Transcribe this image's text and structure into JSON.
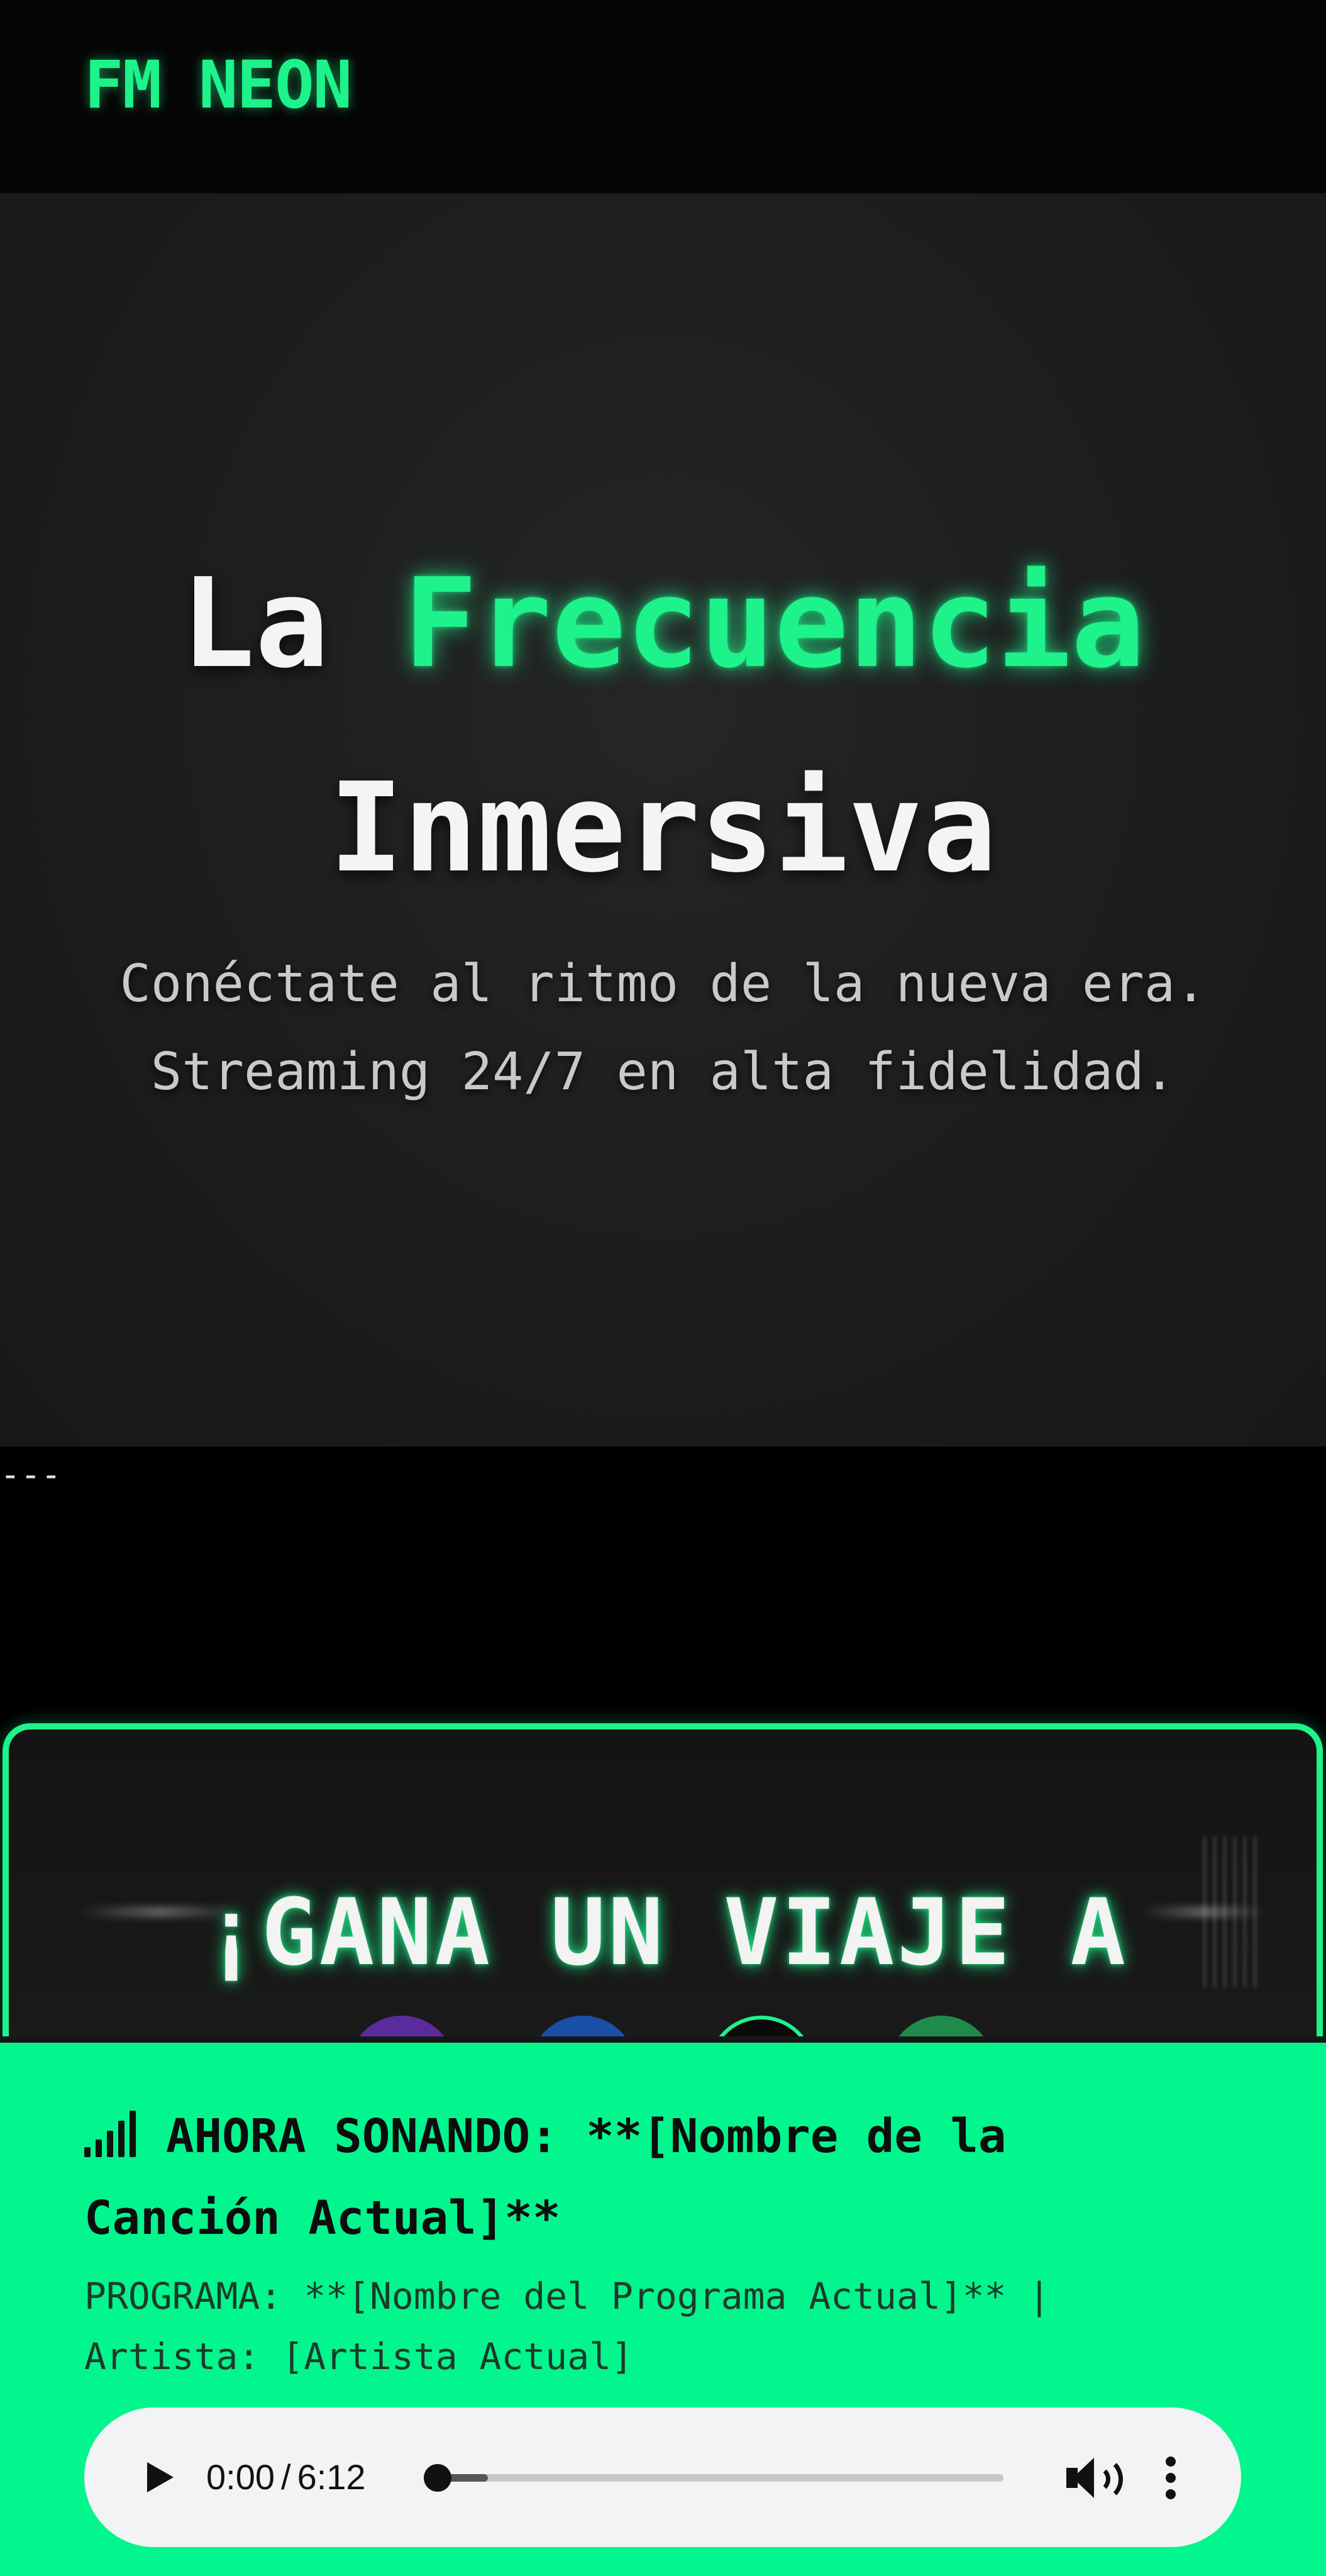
{
  "header": {
    "logo_text": "FM NEON"
  },
  "hero": {
    "title_prefix": "La",
    "title_accent": "Frecuencia",
    "title_line2": "Inmersiva",
    "subtitle_line1": "Conéctate al ritmo de la nueva era.",
    "subtitle_line2": "Streaming 24/7 en alta fidelidad."
  },
  "divider": {
    "text": "---"
  },
  "promo": {
    "title": "¡GANA UN VIAJE A"
  },
  "now_playing": {
    "icon": "signal-bars-icon",
    "headline_line1": "AHORA SONANDO: **[Nombre de la",
    "headline_line2": "Canción Actual]**",
    "sub_line1": "PROGRAMA: **[Nombre del Programa Actual]** |",
    "sub_line2": "Artista: [Artista Actual]"
  },
  "player": {
    "current_time": "0:00",
    "separator": "/",
    "duration": "6:12",
    "progress": 0
  },
  "colors": {
    "accent": "#1ef28b",
    "now_playing_bg": "#03f58e",
    "page_bg": "#000000",
    "hero_bg": "#1f2021"
  }
}
